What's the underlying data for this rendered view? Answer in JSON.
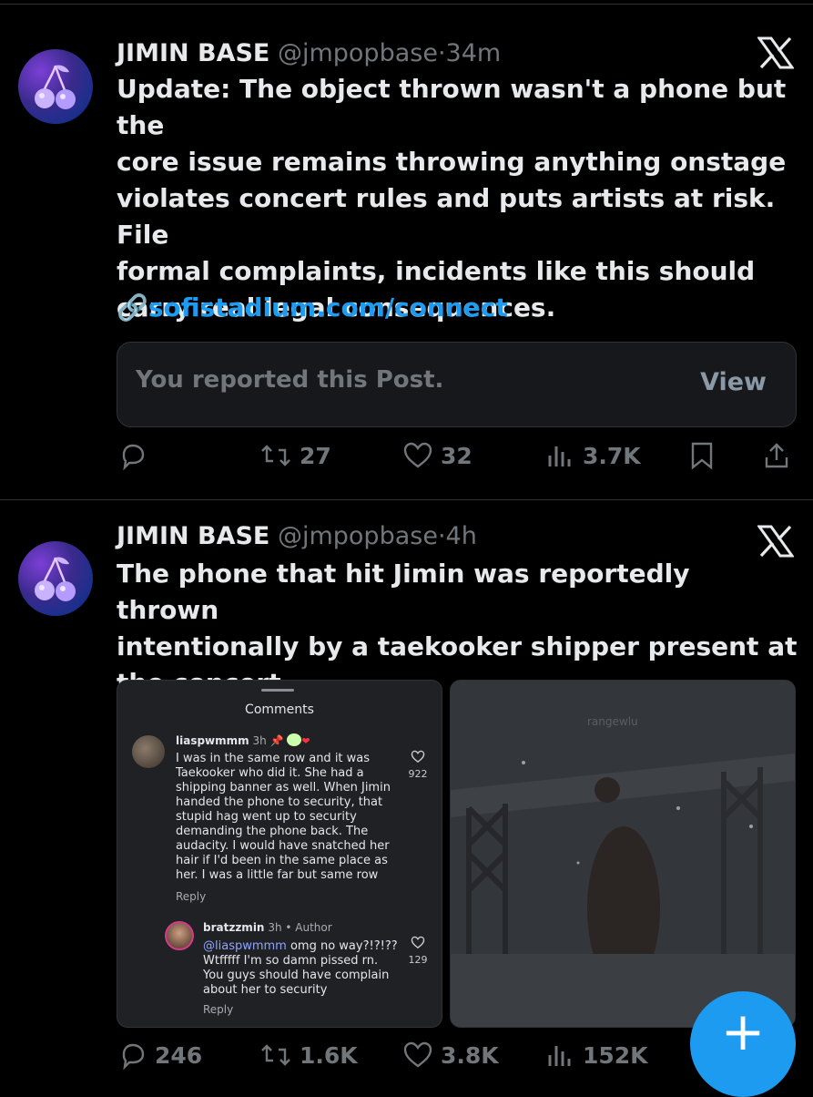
{
  "colors": {
    "background": "#000000",
    "accent": "#1d9bf0",
    "muted": "#71767b",
    "text": "#e7e9ea"
  },
  "posts": [
    {
      "author": "JIMIN BASE",
      "handle": "@jmpopbase",
      "separator": "·",
      "time": "34m",
      "text_lines": [
        "Update: The object thrown wasn't a phone but the",
        "core issue remains throwing anything onstage",
        "violates concert rules and puts artists at risk. File",
        "formal complaints, incidents like this should",
        "carry real legal consequences."
      ],
      "link_icon": "🔗",
      "link": "sofistadium.com/connect",
      "reported": {
        "message": "You reported this Post.",
        "view_label": "View"
      },
      "stats": {
        "replies": "",
        "reposts": "27",
        "likes": "32",
        "views": "3.7K"
      }
    },
    {
      "author": "JIMIN BASE",
      "handle": "@jmpopbase",
      "separator": "·",
      "time": "4h",
      "text_lines": [
        "The phone that hit Jimin was reportedly thrown",
        "intentionally by a taekooker shipper present at",
        "the concert"
      ],
      "media_comments": {
        "title": "Comments",
        "comment1": {
          "user": "liaspwmmm",
          "time": "3h",
          "lines": [
            "I was in the same row and it was",
            "Taekooker who did it. She had a",
            "shipping banner as well. When Jimin",
            "handed the phone to security, that",
            "stupid hag went up to security",
            "demanding the phone back. The",
            "audacity. I would have snatched her",
            "hair if I'd been in the same place as",
            "her. I was a little far but same row"
          ],
          "likes": "922",
          "reply": "Reply"
        },
        "comment2": {
          "user": "bratzzmin",
          "time": "3h",
          "author_tag": "• Author",
          "mention": "@liaspwmmm",
          "first_line_rest": " omg no way?!?!??",
          "lines": [
            "Wtfffff I'm so damn pissed rn.",
            "You guys should have complain",
            "about her to security"
          ],
          "likes": "129",
          "reply": "Reply"
        }
      },
      "media_video_watermark": "rangewlu",
      "stats": {
        "replies": "246",
        "reposts": "1.6K",
        "likes": "3.8K",
        "views": "152K"
      }
    }
  ],
  "fab_label": "+"
}
